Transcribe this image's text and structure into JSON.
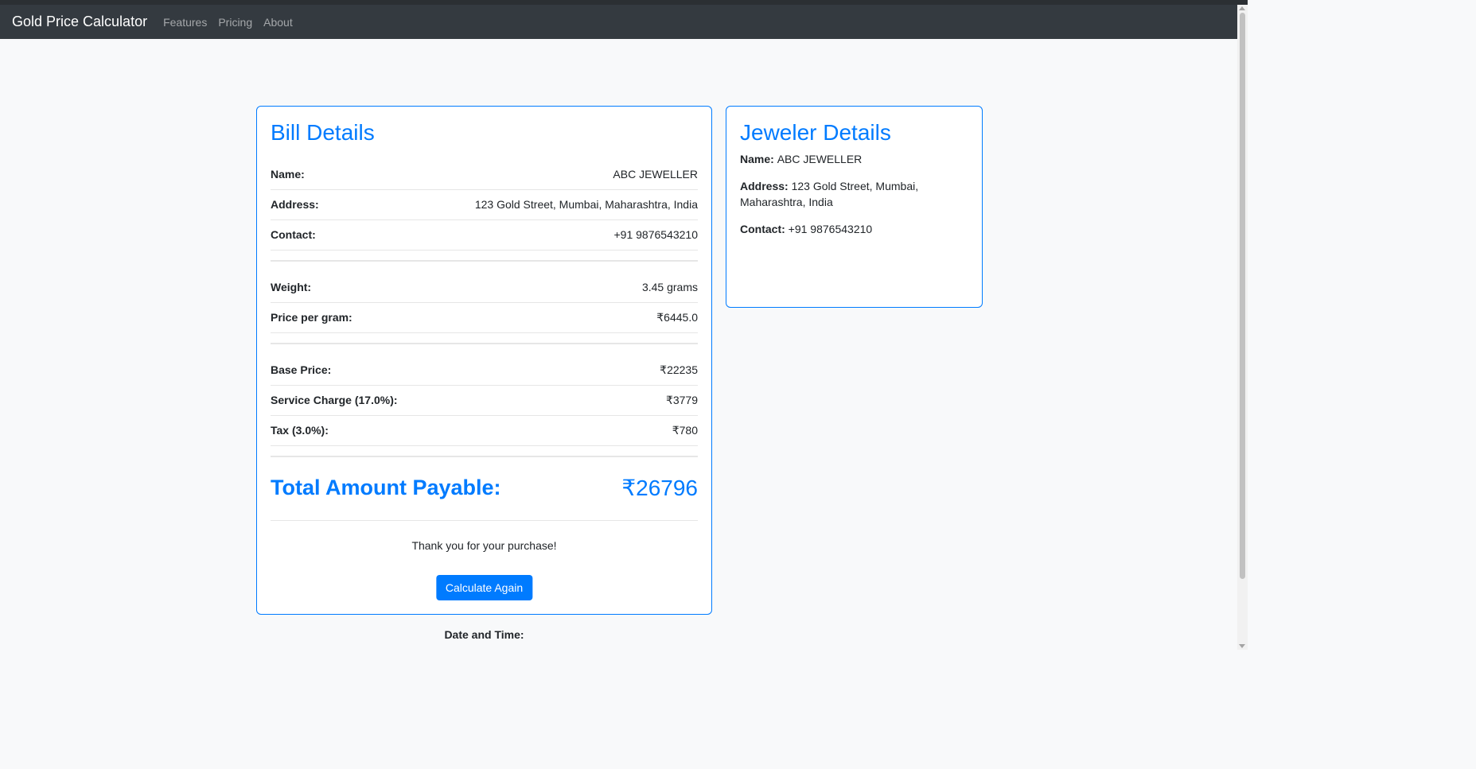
{
  "navbar": {
    "brand": "Gold Price Calculator",
    "links": [
      "Features",
      "Pricing",
      "About"
    ]
  },
  "bill": {
    "title": "Bill Details",
    "rows": [
      {
        "label": "Name:",
        "value": "ABC JEWELLER"
      },
      {
        "label": "Address:",
        "value": "123 Gold Street, Mumbai, Maharashtra, India"
      },
      {
        "label": "Contact:",
        "value": "+91 9876543210"
      },
      {
        "label": "Weight:",
        "value": "3.45 grams"
      },
      {
        "label": "Price per gram:",
        "value": "₹6445.0"
      },
      {
        "label": "Base Price:",
        "value": "₹22235"
      },
      {
        "label": "Service Charge (17.0%):",
        "value": "₹3779"
      },
      {
        "label": "Tax (3.0%):",
        "value": "₹780"
      }
    ],
    "total_label": "Total Amount Payable:",
    "total_value": "₹26796",
    "thanks": "Thank you for your purchase!",
    "button_label": "Calculate Again"
  },
  "jeweler": {
    "title": "Jeweler Details",
    "name_label": "Name:",
    "name_value": "ABC JEWELLER",
    "address_label": "Address:",
    "address_value": "123 Gold Street, Mumbai, Maharashtra, India",
    "contact_label": "Contact:",
    "contact_value": "+91 9876543210"
  },
  "footer": {
    "datetime_label": "Date and Time:"
  },
  "colors": {
    "accent": "#007bff",
    "navbar": "#343a40"
  }
}
